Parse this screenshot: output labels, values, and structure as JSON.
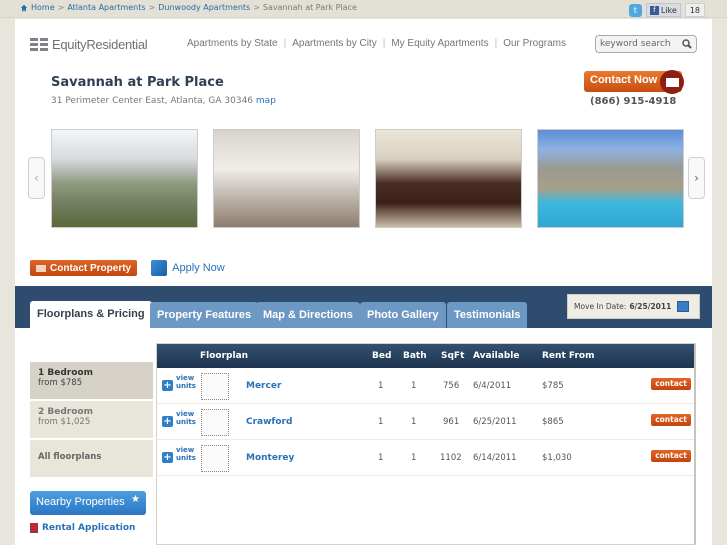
{
  "breadcrumb": {
    "icon": "home-icon",
    "items": [
      "Home",
      "Atlanta Apartments",
      "Dunwoody Apartments"
    ],
    "current": "Savannah at Park Place",
    "separator": ">"
  },
  "social": {
    "twitter_icon": "twitter-icon",
    "like_label": "Like",
    "like_count": "18"
  },
  "header": {
    "logo_text": "EquityResidential",
    "nav": [
      "Apartments by State",
      "Apartments by City",
      "My Equity Apartments",
      "Our Programs"
    ],
    "search_placeholder": "keyword search"
  },
  "property": {
    "name": "Savannah at Park Place",
    "address": "31 Perimeter Center East, Atlanta, GA 30346",
    "map_link": "map",
    "contact_now": "Contact Now",
    "phone": "(866) 915-4918"
  },
  "gallery": {
    "photos": [
      "Building exterior",
      "Kitchen",
      "Living room",
      "Pool and clubhouse"
    ]
  },
  "actions": {
    "contact_property": "Contact Property",
    "apply_now": "Apply Now"
  },
  "tabs": [
    {
      "label": "Floorplans & Pricing",
      "active": true
    },
    {
      "label": "Property Features",
      "active": false
    },
    {
      "label": "Map & Directions",
      "active": false
    },
    {
      "label": "Photo Gallery",
      "active": false
    },
    {
      "label": "Testimonials",
      "active": false
    }
  ],
  "move_in": {
    "label": "Move In Date:",
    "date": "6/25/2011"
  },
  "bedroom_filters": [
    {
      "title": "1 Bedroom",
      "sub": "from $785",
      "active": true
    },
    {
      "title": "2 Bedroom",
      "sub": "from $1,025",
      "active": false
    },
    {
      "title": "All floorplans",
      "sub": "",
      "active": false
    }
  ],
  "sidebar": {
    "nearby": "Nearby Properties",
    "rental_application": "Rental Application"
  },
  "table": {
    "headers": [
      "Floorplan",
      "Bed",
      "Bath",
      "SqFt",
      "Available",
      "Rent From"
    ],
    "view_units_line1": "view",
    "view_units_line2": "units",
    "contact_label": "contact",
    "rows": [
      {
        "name": "Mercer",
        "bed": "1",
        "bath": "1",
        "sqft": "756",
        "available": "6/4/2011",
        "rent": "$785"
      },
      {
        "name": "Crawford",
        "bed": "1",
        "bath": "1",
        "sqft": "961",
        "available": "6/25/2011",
        "rent": "$865"
      },
      {
        "name": "Monterey",
        "bed": "1",
        "bath": "1",
        "sqft": "1102",
        "available": "6/14/2011",
        "rent": "$1,030"
      }
    ]
  }
}
